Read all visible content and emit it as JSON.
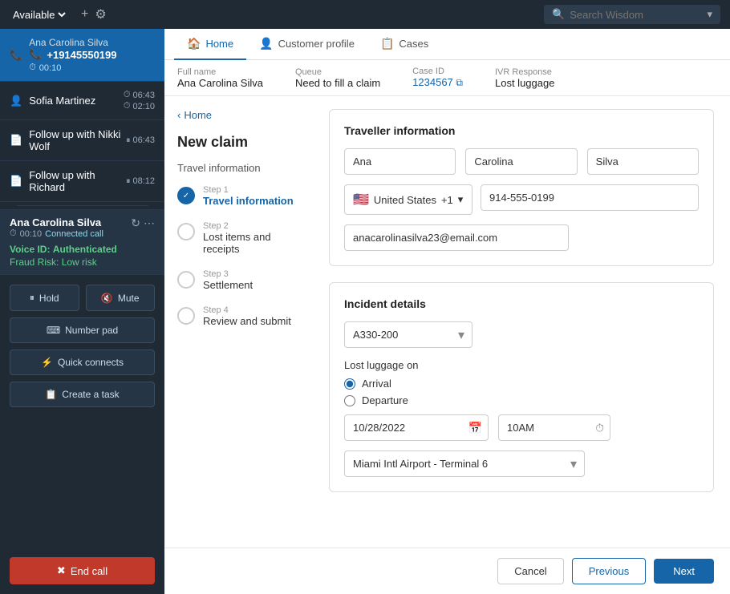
{
  "topbar": {
    "status": "Available",
    "add_icon": "+",
    "settings_icon": "⚙",
    "search_placeholder": "Search Wisdom",
    "dropdown_icon": "▾"
  },
  "left_panel": {
    "call_list": [
      {
        "icon": "📞",
        "number": "+19145550199",
        "timer": "00:10",
        "is_active": true
      },
      {
        "name": "Sofia Martinez",
        "time1": "06:43",
        "time2": "02:10",
        "paused": false
      },
      {
        "name": "Follow up with Nikki Wolf",
        "time": "06:43",
        "paused": true
      },
      {
        "name": "Follow up with Richard",
        "time": "08:12",
        "paused": true
      }
    ],
    "active_agent": {
      "name": "Ana Carolina Silva",
      "timer": "00:10",
      "connected_label": "Connected call",
      "voice_id_label": "Voice ID:",
      "voice_id_value": "Authenticated",
      "fraud_risk_label": "Fraud Risk:",
      "fraud_risk_value": "Low risk"
    },
    "controls": {
      "hold_label": "Hold",
      "mute_label": "Mute",
      "number_pad_label": "Number pad",
      "quick_connects_label": "Quick connects",
      "create_task_label": "Create a task",
      "end_call_label": "End call"
    }
  },
  "right_panel": {
    "tabs": [
      {
        "label": "Home",
        "icon": "🏠",
        "active": true
      },
      {
        "label": "Customer profile",
        "icon": "👤",
        "active": false
      },
      {
        "label": "Cases",
        "icon": "📋",
        "active": false
      }
    ],
    "info_bar": {
      "full_name_label": "Full name",
      "full_name_value": "Ana Carolina Silva",
      "queue_label": "Queue",
      "queue_value": "Need to fill a claim",
      "case_id_label": "Case ID",
      "case_id_value": "1234567",
      "ivr_label": "IVR Response",
      "ivr_value": "Lost luggage"
    },
    "sidebar": {
      "back_label": "Home",
      "page_title": "New claim",
      "section_label": "Travel information",
      "steps": [
        {
          "number": "1",
          "label": "Step 1",
          "name": "Travel information",
          "active": true
        },
        {
          "number": "2",
          "label": "Step 2",
          "name": "Lost items and receipts",
          "active": false
        },
        {
          "number": "3",
          "label": "Step 3",
          "name": "Settlement",
          "active": false
        },
        {
          "number": "4",
          "label": "Step 4",
          "name": "Review and submit",
          "active": false
        }
      ]
    },
    "form": {
      "traveller_section": "Traveller information",
      "first_name": "Ana",
      "middle_name": "Carolina",
      "last_name": "Silva",
      "country": "United States",
      "country_code": "+1",
      "phone": "914-555-0199",
      "email": "anacarolinasilva23@email.com",
      "incident_section": "Incident details",
      "aircraft_value": "A330-200",
      "lost_luggage_label": "Lost luggage on",
      "arrival_label": "Arrival",
      "departure_label": "Departure",
      "date_value": "10/28/2022",
      "time_value": "10AM",
      "airport_value": "Miami Intl Airport  - Terminal 6"
    },
    "footer": {
      "cancel_label": "Cancel",
      "previous_label": "Previous",
      "next_label": "Next"
    }
  }
}
